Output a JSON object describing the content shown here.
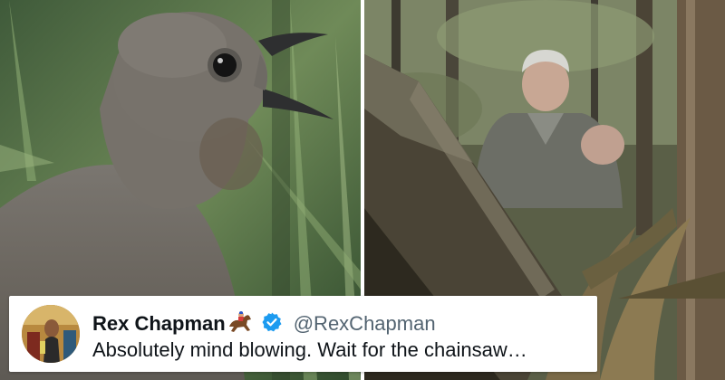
{
  "tweet": {
    "display_name": "Rex Chapman",
    "name_emoji_icon": "horse-racing-icon",
    "verified_icon": "verified-badge-icon",
    "verified_color": "#1d9bf0",
    "handle": "@RexChapman",
    "text": "Absolutely mind blowing. Wait for the chainsaw…"
  },
  "images": {
    "left": "lyrebird-photo",
    "right": "man-in-forest-photo"
  }
}
